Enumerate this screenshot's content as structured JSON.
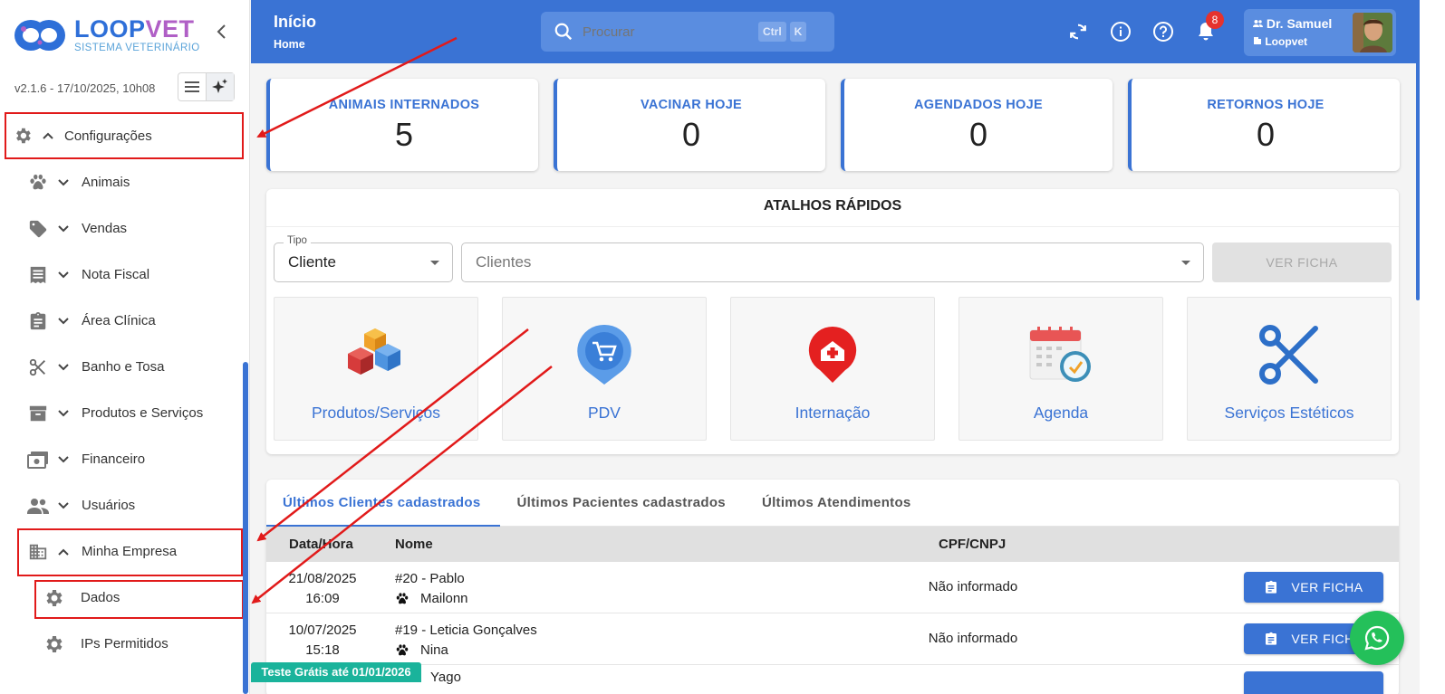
{
  "sidebar": {
    "logo_loop": "LOOP",
    "logo_vet": "VET",
    "logo_subtitle": "SISTEMA VETERINÁRIO",
    "version": "v2.1.6 - 17/10/2025, 10h08",
    "items": [
      {
        "label": "Configurações",
        "icon": "gear-icon",
        "expanded": true
      },
      {
        "label": "Animais",
        "icon": "paw-icon"
      },
      {
        "label": "Vendas",
        "icon": "tag-icon"
      },
      {
        "label": "Nota Fiscal",
        "icon": "receipt-icon"
      },
      {
        "label": "Área Clínica",
        "icon": "clipboard-icon"
      },
      {
        "label": "Banho e Tosa",
        "icon": "scissors-icon"
      },
      {
        "label": "Produtos e Serviços",
        "icon": "archive-icon"
      },
      {
        "label": "Financeiro",
        "icon": "money-icon"
      },
      {
        "label": "Usuários",
        "icon": "users-icon"
      },
      {
        "label": "Minha Empresa",
        "icon": "building-icon",
        "expanded": true
      }
    ],
    "subitems": [
      {
        "label": "Dados",
        "icon": "gear-icon"
      },
      {
        "label": "IPs Permitidos",
        "icon": "gear-icon"
      }
    ],
    "trial_badge": "Teste Grátis até 01/01/2026"
  },
  "header": {
    "title": "Início",
    "subtitle": "Home",
    "search_placeholder": "Procurar",
    "shortcut_ctrl": "Ctrl",
    "shortcut_k": "K",
    "notification_count": "8",
    "user_name": "Dr. Samuel",
    "user_org": "Loopvet"
  },
  "stats": [
    {
      "title": "ANIMAIS INTERNADOS",
      "value": "5"
    },
    {
      "title": "VACINAR HOJE",
      "value": "0"
    },
    {
      "title": "AGENDADOS HOJE",
      "value": "0"
    },
    {
      "title": "RETORNOS HOJE",
      "value": "0"
    }
  ],
  "shortcuts": {
    "title": "ATALHOS RÁPIDOS",
    "type_legend": "Tipo",
    "type_value": "Cliente",
    "client_placeholder": "Clientes",
    "view_button": "VER FICHA",
    "tiles": [
      {
        "label": "Produtos/Serviços",
        "icon": "boxes-icon"
      },
      {
        "label": "PDV",
        "icon": "cart-icon"
      },
      {
        "label": "Internação",
        "icon": "hospital-icon"
      },
      {
        "label": "Agenda",
        "icon": "calendar-icon"
      },
      {
        "label": "Serviços Estéticos",
        "icon": "scissors-icon"
      }
    ]
  },
  "tabs": [
    {
      "label": "Últimos Clientes cadastrados",
      "active": true
    },
    {
      "label": "Últimos Pacientes cadastrados",
      "active": false
    },
    {
      "label": "Últimos Atendimentos",
      "active": false
    }
  ],
  "table": {
    "columns": [
      "Data/Hora",
      "Nome",
      "CPF/CNPJ"
    ],
    "rows": [
      {
        "date": "21/08/2025",
        "time": "16:09",
        "name": "#20 - Pablo",
        "pet": "Mailonn",
        "cpf": "Não informado",
        "button": "VER FICHA"
      },
      {
        "date": "10/07/2025",
        "time": "15:18",
        "name": "#19 - Leticia Gonçalves",
        "pet": "Nina",
        "cpf": "Não informado",
        "button": "VER FICHA"
      },
      {
        "date": "",
        "time": "",
        "name": "",
        "pet": "Yago",
        "cpf": "",
        "button": ""
      }
    ]
  },
  "colors": {
    "primary": "#3a73d4",
    "highlight_red": "#e11a1a",
    "whatsapp": "#24c05a",
    "trial": "#1ab39b"
  }
}
